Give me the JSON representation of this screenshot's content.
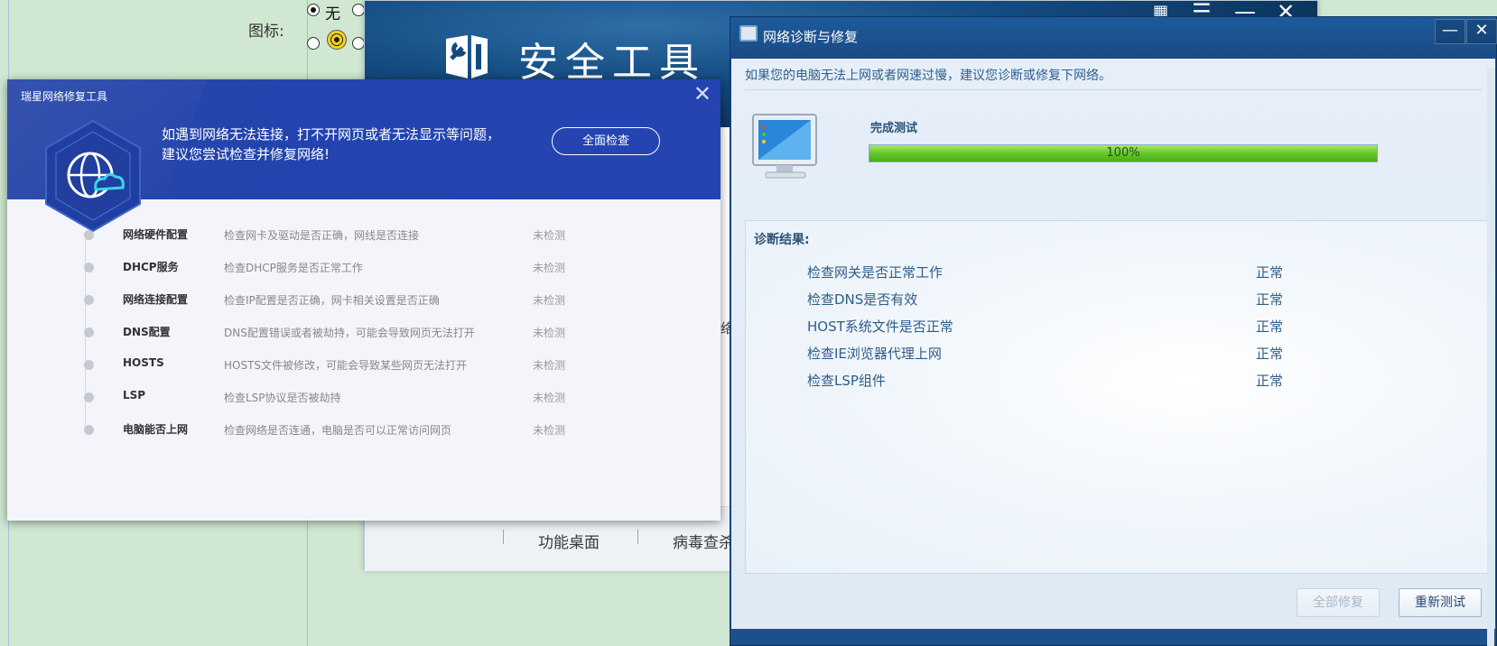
{
  "background": {
    "icon_label": "图标:",
    "radio_none_label": "无"
  },
  "security_tool": {
    "title": "安全工具",
    "tabs": [
      "功能桌面",
      "病毒查杀"
    ],
    "partial_glyph": "络"
  },
  "ruixing": {
    "window_title": "瑞星网络修复工具",
    "message_line1": "如遇到网络无法连接，打不开网页或者无法显示等问题，",
    "message_line2": "建议您尝试检查并修复网络!",
    "full_check_button": "全面检查",
    "items": [
      {
        "name": "网络硬件配置",
        "desc": "检查网卡及驱动是否正确，网线是否连接",
        "status": "未检测"
      },
      {
        "name": "DHCP服务",
        "desc": "检查DHCP服务是否正常工作",
        "status": "未检测"
      },
      {
        "name": "网络连接配置",
        "desc": "检查IP配置是否正确，网卡相关设置是否正确",
        "status": "未检测"
      },
      {
        "name": "DNS配置",
        "desc": "DNS配置错误或者被劫持，可能会导致网页无法打开",
        "status": "未检测"
      },
      {
        "name": "HOSTS",
        "desc": "HOSTS文件被修改，可能会导致某些网页无法打开",
        "status": "未检测"
      },
      {
        "name": "LSP",
        "desc": "检查LSP协议是否被劫持",
        "status": "未检测"
      },
      {
        "name": "电脑能否上网",
        "desc": "检查网络是否连通，电脑是否可以正常访问网页",
        "status": "未检测"
      }
    ]
  },
  "net_diag": {
    "window_title": "网络诊断与修复",
    "tip": "如果您的电脑无法上网或者网速过慢，建议您诊断或修复下网络。",
    "done_label": "完成测试",
    "progress_percent": 100,
    "progress_text": "100%",
    "results_title": "诊断结果:",
    "results": [
      {
        "check": "检查网关是否正常工作",
        "status": "正常"
      },
      {
        "check": "检查DNS是否有效",
        "status": "正常"
      },
      {
        "check": "HOST系统文件是否正常",
        "status": "正常"
      },
      {
        "check": "检查IE浏览器代理上网",
        "status": "正常"
      },
      {
        "check": "检查LSP组件",
        "status": "正常"
      }
    ],
    "repair_all_button": "全部修复",
    "retest_button": "重新测试",
    "progress_color": "#66c72a"
  }
}
